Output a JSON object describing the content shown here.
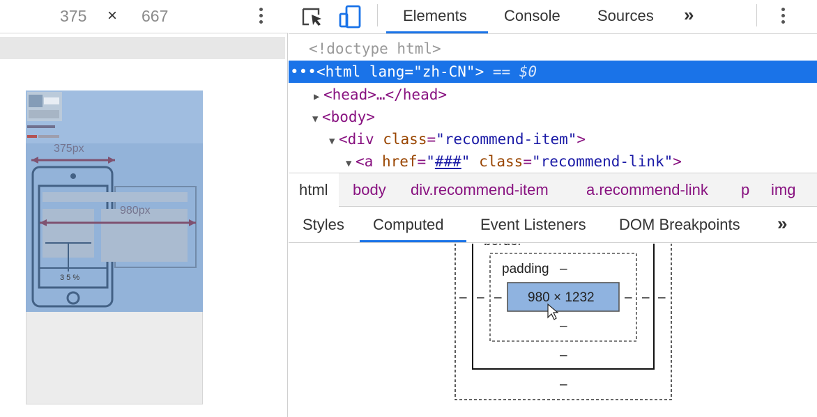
{
  "device_toolbar": {
    "width": "375",
    "times": "×",
    "height": "667"
  },
  "viewport_preview": {
    "label_375": "375px",
    "label_980": "980px",
    "label_pct": "3 5 %",
    "highlight_color": "#8fb0d9"
  },
  "toolbar": {
    "tabs": [
      "Elements",
      "Console",
      "Sources"
    ],
    "more": "»",
    "accent": "#1a73e8"
  },
  "dom": {
    "doctype": "<!doctype html>",
    "html_open": "<html lang=\"zh-CN\">",
    "html_tag": "html",
    "html_attr": "lang",
    "html_val": "\"zh-CN\"",
    "eq": "== $0",
    "head_line": "<head>…</head>",
    "body_line": "<body>",
    "div_tag": "div",
    "div_attr": "class",
    "div_val": "\"recommend-item\"",
    "a_tag": "a",
    "a_href": "href",
    "a_href_val": "###",
    "a_class": "class",
    "a_class_val": "\"recommend-link\""
  },
  "breadcrumbs": [
    "html",
    "body",
    "div.recommend-item",
    "a.recommend-link",
    "p",
    "img"
  ],
  "subtabs": [
    "Styles",
    "Computed",
    "Event Listeners",
    "DOM Breakpoints"
  ],
  "subtabs_more": "»",
  "box_model": {
    "border_label": "border",
    "padding_label": "padding",
    "padding_top": "–",
    "content_size": "980 × 1232",
    "dash": "–",
    "content_color": "#8fb3e0"
  }
}
